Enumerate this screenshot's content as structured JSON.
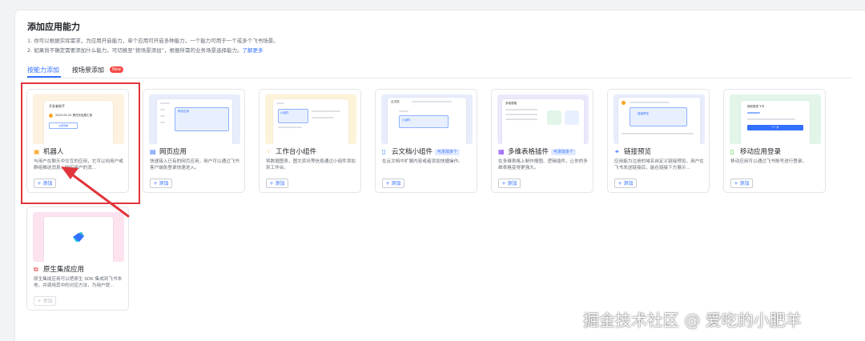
{
  "header": {
    "title": "添加应用能力",
    "desc_line1": "1. 你可以根据实际需求，为应用开启能力，单个应用可开启多种能力，一个能力可用于一个或多个飞书场景。",
    "desc_line2_prefix": "2. 如果尚不确定需要添加什么能力，可切换至“按场景添加”，根据所需的业务场景选择能力。",
    "learn_more": "了解更多"
  },
  "tabs": [
    {
      "label": "按能力添加",
      "active": true
    },
    {
      "label": "按场景添加",
      "badge": "New"
    }
  ],
  "cards": [
    {
      "name": "机器人",
      "icon": "robot-icon",
      "desc": "与用户在聊天中交互的应用，它可以向用户或群组推送消息，响应用户的消...",
      "add": "+ 添加",
      "thumb_color": "#fdf1df",
      "thumb_text1": "开发者助手",
      "thumb_text2": "2020-05-20 周任务进展汇报",
      "thumb_btn": "立即查看"
    },
    {
      "name": "网页应用",
      "icon": "web-icon",
      "desc": "快速接入已有的网页应用，用户可以通过飞书客户端免登录快速进入。",
      "add": "+ 添加",
      "thumb_color": "#e8edfc",
      "thumb_text1": "网页应用"
    },
    {
      "name": "工作台小组件",
      "icon": "widget-icon",
      "desc": "将数据图表，图文资讯等信息通过小组件添加到工作台。",
      "add": "+ 添加",
      "thumb_color": "#fdf3d9",
      "thumb_text1": "小组件"
    },
    {
      "name": "云文档小组件",
      "icon": "doc-icon",
      "tag": "可添加多个",
      "desc": "在云文档中扩展内容或者添加快捷操作。",
      "add": "+ 添加",
      "thumb_color": "#e8edfc",
      "thumb_text1": "云文档",
      "thumb_text2": "小组件"
    },
    {
      "name": "多维表格插件",
      "icon": "table-icon",
      "tag": "可添加多个",
      "desc": "在多维表格上制作报图、逻辑插件，让你的多维表格变得更强大。",
      "add": "+ 添加",
      "thumb_color": "#ece9fb",
      "thumb_text1": "多维表格"
    },
    {
      "name": "链接预览",
      "icon": "link-icon",
      "desc": "应用能为注册的域名自定义链接预览，用户在飞书发送链接后，能在链接下方展示...",
      "add": "+ 添加",
      "thumb_color": "#e8edfc",
      "thumb_text1": "链接预览"
    },
    {
      "name": "移动应用登录",
      "icon": "mobile-icon",
      "desc": "移动应用可以通过飞书账号进行登录。",
      "add": "+ 添加",
      "thumb_color": "#e2f5e8",
      "thumb_text1": "授权登录飞书",
      "thumb_btn": "下一步"
    },
    {
      "name": "原生集成应用",
      "icon": "native-icon",
      "desc": "原生集成应用可以把原生 SDK 集成到飞书本地，并调用其中的对应方法，为用户提...",
      "add": "+ 添加",
      "disabled": true,
      "thumb_color": "#fce3ef"
    }
  ],
  "watermark": "掘金技术社区 @ 爱吃的小肥羊"
}
